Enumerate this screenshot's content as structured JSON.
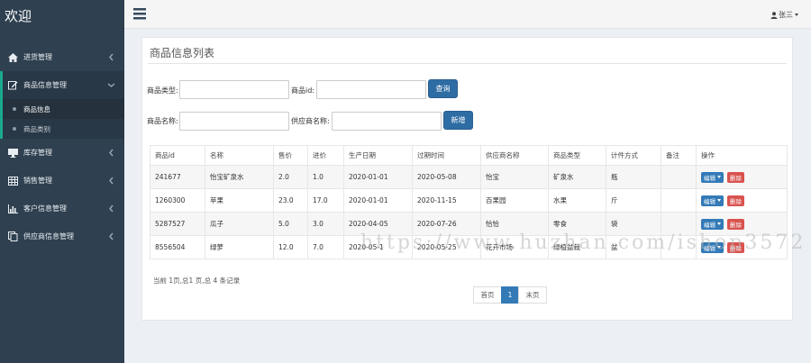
{
  "sidebar": {
    "brand": "欢迎",
    "items": [
      {
        "label": "进货管理",
        "icon": "home-icon"
      },
      {
        "label": "商品信息管理",
        "icon": "edit-icon"
      },
      {
        "label": "库存管理",
        "icon": "desktop-icon"
      },
      {
        "label": "销售管理",
        "icon": "table-icon"
      },
      {
        "label": "客户信息管理",
        "icon": "bar-chart-icon"
      },
      {
        "label": "供应商信息管理",
        "icon": "copy-icon"
      }
    ],
    "subitems": [
      {
        "label": "商品信息"
      },
      {
        "label": "商品类别"
      }
    ]
  },
  "header": {
    "user": "张三"
  },
  "panel": {
    "title": "商品信息列表"
  },
  "search": {
    "type_label": "商品类型:",
    "id_label": "商品id:",
    "query_button": "查询",
    "name_label": "商品名称:",
    "supplier_label": "供应商名称:",
    "add_button": "新增"
  },
  "table": {
    "headers": [
      "商品id",
      "名称",
      "售价",
      "进价",
      "生产日期",
      "过期时间",
      "供应商名称",
      "商品类型",
      "计件方式",
      "备注",
      "操作"
    ],
    "rows": [
      [
        "241677",
        "怡宝矿泉水",
        "2.0",
        "1.0",
        "2020-01-01",
        "2020-05-08",
        "怡宝",
        "矿泉水",
        "瓶",
        ""
      ],
      [
        "1260300",
        "苹果",
        "23.0",
        "17.0",
        "2020-01-01",
        "2020-11-15",
        "百果园",
        "水果",
        "斤",
        ""
      ],
      [
        "5287527",
        "瓜子",
        "5.0",
        "3.0",
        "2020-04-05",
        "2020-07-26",
        "恰恰",
        "零食",
        "袋",
        ""
      ],
      [
        "8556504",
        "绿萝",
        "12.0",
        "7.0",
        "2020-05-1",
        "2020-05-25",
        "花卉市场",
        "绿植盆栽",
        "盆",
        ""
      ]
    ],
    "edit_label": "编辑",
    "delete_label": "删除"
  },
  "footer": {
    "summary": "当前 1页,总1 页,总 4 条记录",
    "first": "首页",
    "current": "1",
    "last": "末页"
  },
  "watermark": "https://www.huzhan.com/ishop3572",
  "colors": {
    "sidebar_bg": "#2f4050",
    "accent": "#19aa8d",
    "primary": "#337ab7",
    "danger": "#d9534f"
  }
}
